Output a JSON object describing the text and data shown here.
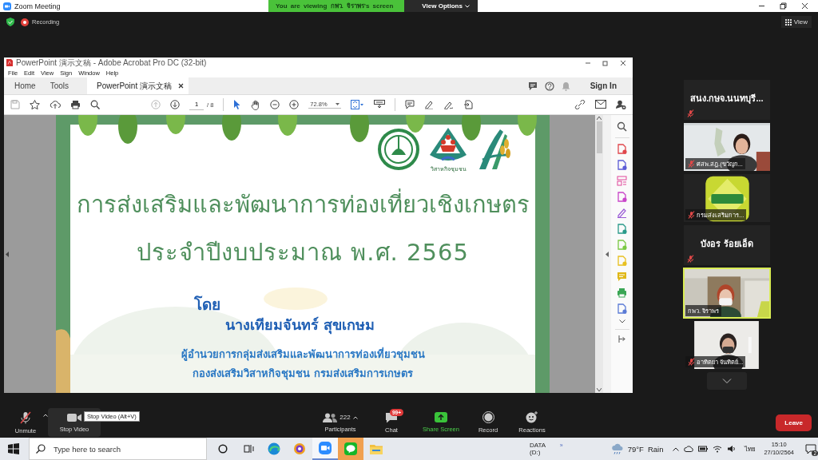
{
  "zoom_window": {
    "title": "Zoom Meeting",
    "banner": "You are viewing กพว. จิราพร's screen",
    "view_options": "View Options"
  },
  "meeting_bar": {
    "recording": "Recording",
    "view": "View"
  },
  "acrobat": {
    "title": "PowerPoint 演示文稿 - Adobe Acrobat Pro DC (32-bit)",
    "menu": [
      "File",
      "Edit",
      "View",
      "Sign",
      "Window",
      "Help"
    ],
    "tabs": [
      {
        "label": "Home",
        "selected": false
      },
      {
        "label": "Tools",
        "selected": false
      },
      {
        "label": "PowerPoint 演示文稿",
        "selected": true
      }
    ],
    "sign_in": "Sign In",
    "page": "1",
    "page_total": "/ 8",
    "zoom": "72.8%"
  },
  "slide": {
    "logo_caption": "วิสาหกิจชุมชน",
    "title_lines": [
      "การส่งเสริมและพัฒนาการท่องเที่ยวเชิงเกษตร",
      "ประจำปีงบประมาณ พ.ศ. 2565"
    ],
    "by": "โดย",
    "presenter": "นางเทียมจันทร์ สุขเกษม",
    "position_lines": [
      "ผู้อำนวยการกลุ่มส่งเสริมและพัฒนาการท่องเที่ยวชุมชน",
      "กองส่งเสริมวิสาหกิจชุมชน กรมส่งเสริมการเกษตร"
    ]
  },
  "participants": [
    {
      "kind": "name",
      "name": "สนง.กษจ.นนทบุรี...",
      "muted": true,
      "active": false
    },
    {
      "kind": "video",
      "name": "ศสพ.สฎ.(ขวัญก...",
      "muted": true,
      "active": false
    },
    {
      "kind": "avatar",
      "name": "กรมส่งเสริมการ...",
      "muted": true,
      "active": false
    },
    {
      "kind": "name",
      "name": "บังอร ร้อยเอ็ด",
      "muted": true,
      "active": false
    },
    {
      "kind": "video",
      "name": "กพว. จิราพร",
      "muted": false,
      "active": true
    },
    {
      "kind": "video",
      "name": "อาทิตยา จันทิตย์...",
      "muted": true,
      "active": false
    }
  ],
  "toolbar": {
    "unmute": "Unmute",
    "stop_video": "Stop Video",
    "tooltip": "Stop Video (Alt+V)",
    "participants_count": "222",
    "participants": "Participants",
    "chat": "Chat",
    "chat_badge": "99+",
    "share_screen": "Share Screen",
    "record": "Record",
    "reactions": "Reactions",
    "leave": "Leave"
  },
  "taskbar": {
    "search_placeholder": "Type here to search",
    "apps": [
      {
        "kind": "edge",
        "running": false,
        "flashing": false
      },
      {
        "kind": "browser",
        "running": false,
        "flashing": false
      },
      {
        "kind": "zoom",
        "running": true,
        "flashing": false
      },
      {
        "kind": "line",
        "running": false,
        "flashing": true
      },
      {
        "kind": "explorer",
        "running": false,
        "flashing": false
      }
    ],
    "drive": "DATA (D:)",
    "chevron": "»",
    "temperature": "79°F",
    "weather": "Rain",
    "language": "ไทย",
    "time": "15:10",
    "date": "27/10/2564",
    "notifications": "2"
  }
}
